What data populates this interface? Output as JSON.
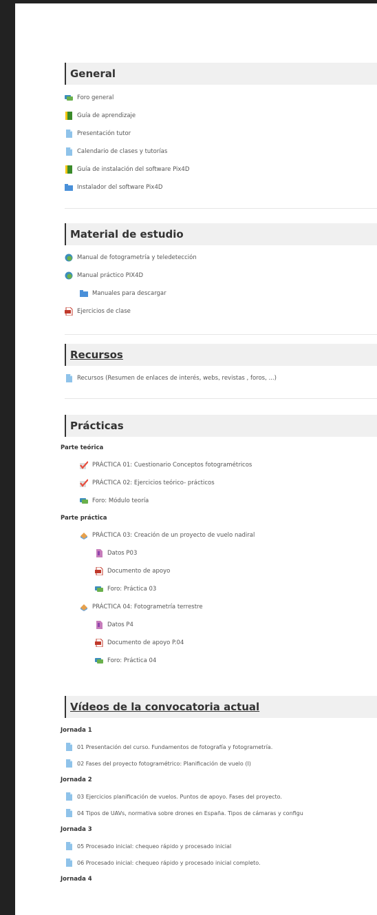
{
  "sections": {
    "general": {
      "title": "General",
      "items": [
        {
          "label": "Foro general",
          "icon": "forum-icon"
        },
        {
          "label": "Guía de aprendizaje",
          "icon": "book-icon"
        },
        {
          "label": "Presentación tutor",
          "icon": "page-icon"
        },
        {
          "label": "Calendario de clases y tutorías",
          "icon": "page-icon"
        },
        {
          "label": "Guía de instalación del software Pix4D",
          "icon": "book-icon"
        },
        {
          "label": "Instalador del software Pix4D",
          "icon": "folder-icon"
        }
      ]
    },
    "material": {
      "title": "Material de estudio",
      "items": [
        {
          "label": "Manual de fotogrametría y teledetección",
          "icon": "package-icon"
        },
        {
          "label": "Manual práctico PIX4D",
          "icon": "package-icon"
        },
        {
          "label": "Manuales para descargar",
          "icon": "folder-icon"
        },
        {
          "label": "Ejercicios de clase",
          "icon": "pdf-icon"
        }
      ]
    },
    "recursos": {
      "title": "Recursos",
      "items": [
        {
          "label": "Recursos (Resumen de enlaces de interés, webs, revistas , foros, ...)",
          "icon": "page-icon"
        }
      ]
    },
    "practicas": {
      "title": "Prácticas",
      "teorica_label": "Parte teórica",
      "teorica": [
        {
          "label": "PRÁCTICA 01: Cuestionario Conceptos fotogramétricos",
          "icon": "quiz-icon"
        },
        {
          "label": "PRÁCTICA 02: Ejercicios teórico- prácticos",
          "icon": "quiz-icon"
        },
        {
          "label": "Foro: Módulo teoría",
          "icon": "forum-icon"
        }
      ],
      "practica_label": "Parte práctica",
      "p03": "PRÁCTICA 03: Creación de un proyecto de vuelo nadiral",
      "p03_items": [
        {
          "label": "Datos P03",
          "icon": "archive-icon"
        },
        {
          "label": "Documento de apoyo",
          "icon": "pdf-icon"
        },
        {
          "label": "Foro: Práctica 03",
          "icon": "forum-icon"
        }
      ],
      "p04": "PRÁCTICA 04: Fotogrametría terrestre",
      "p04_items": [
        {
          "label": "Datos P4",
          "icon": "archive-icon"
        },
        {
          "label": "Documento de apoyo P.04",
          "icon": "pdf-icon"
        },
        {
          "label": "Foro: Práctica 04",
          "icon": "forum-icon"
        }
      ]
    },
    "videos": {
      "title": "Vídeos de la convocatoria actual",
      "jornada1": "Jornada 1",
      "v01": "01 Presentación del curso. Fundamentos de fotografía y fotogrametría.",
      "v02": "02 Fases del proyecto fotogramétrico: Planificación de vuelo (I)",
      "jornada2": "Jornada 2",
      "v03": "03 Ejercicios planificación de vuelos. Puntos de apoyo. Fases del proyecto.",
      "v04": "04 Tipos de UAVs, normativa sobre drones en España. Tipos de cámaras y configu",
      "jornada3": "Jornada 3",
      "v05": "05 Procesado inicial: chequeo rápido y procesado inicial",
      "v06": "06 Procesado inicial: chequeo rápido y procesado inicial completo.",
      "jornada4": "Jornada 4"
    }
  }
}
